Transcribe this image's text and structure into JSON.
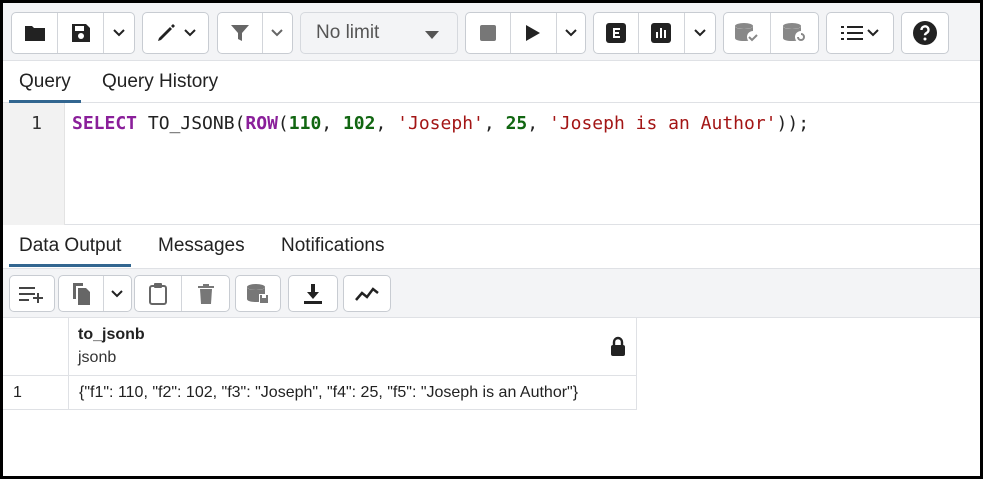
{
  "toolbar": {
    "limit_label": "No limit",
    "icons": [
      "folder-icon",
      "save-icon",
      "chevron-down-icon",
      "edit-pen-icon",
      "filter-icon",
      "stop-icon",
      "play-icon",
      "explain-icon",
      "explain-analyze-icon",
      "commit-icon",
      "rollback-icon",
      "macros-icon",
      "help-icon"
    ]
  },
  "query_tabs": [
    {
      "label": "Query",
      "active": true
    },
    {
      "label": "Query History",
      "active": false
    }
  ],
  "editor": {
    "line_number": "1",
    "tokens": [
      {
        "t": "SELECT",
        "c": "kw"
      },
      {
        "t": " TO_JSONB(",
        "c": "fn"
      },
      {
        "t": "ROW",
        "c": "kw"
      },
      {
        "t": "(",
        "c": "fn"
      },
      {
        "t": "110",
        "c": "num"
      },
      {
        "t": ", ",
        "c": "fn"
      },
      {
        "t": "102",
        "c": "num"
      },
      {
        "t": ", ",
        "c": "fn"
      },
      {
        "t": "'Joseph'",
        "c": "str"
      },
      {
        "t": ", ",
        "c": "fn"
      },
      {
        "t": "25",
        "c": "num"
      },
      {
        "t": ", ",
        "c": "fn"
      },
      {
        "t": "'Joseph is an Author'",
        "c": "str"
      },
      {
        "t": "));",
        "c": "fn"
      }
    ]
  },
  "result_tabs": [
    {
      "label": "Data Output",
      "active": true
    },
    {
      "label": "Messages",
      "active": false
    },
    {
      "label": "Notifications",
      "active": false
    }
  ],
  "grid": {
    "column": {
      "name": "to_jsonb",
      "type": "jsonb"
    },
    "rows": [
      {
        "num": "1",
        "value": "{\"f1\": 110, \"f2\": 102, \"f3\": \"Joseph\", \"f4\": 25, \"f5\": \"Joseph is an Author\"}"
      }
    ]
  },
  "colors": {
    "accent": "#326690",
    "keyword": "#8a1f9a",
    "number": "#116611",
    "string": "#a31515"
  }
}
